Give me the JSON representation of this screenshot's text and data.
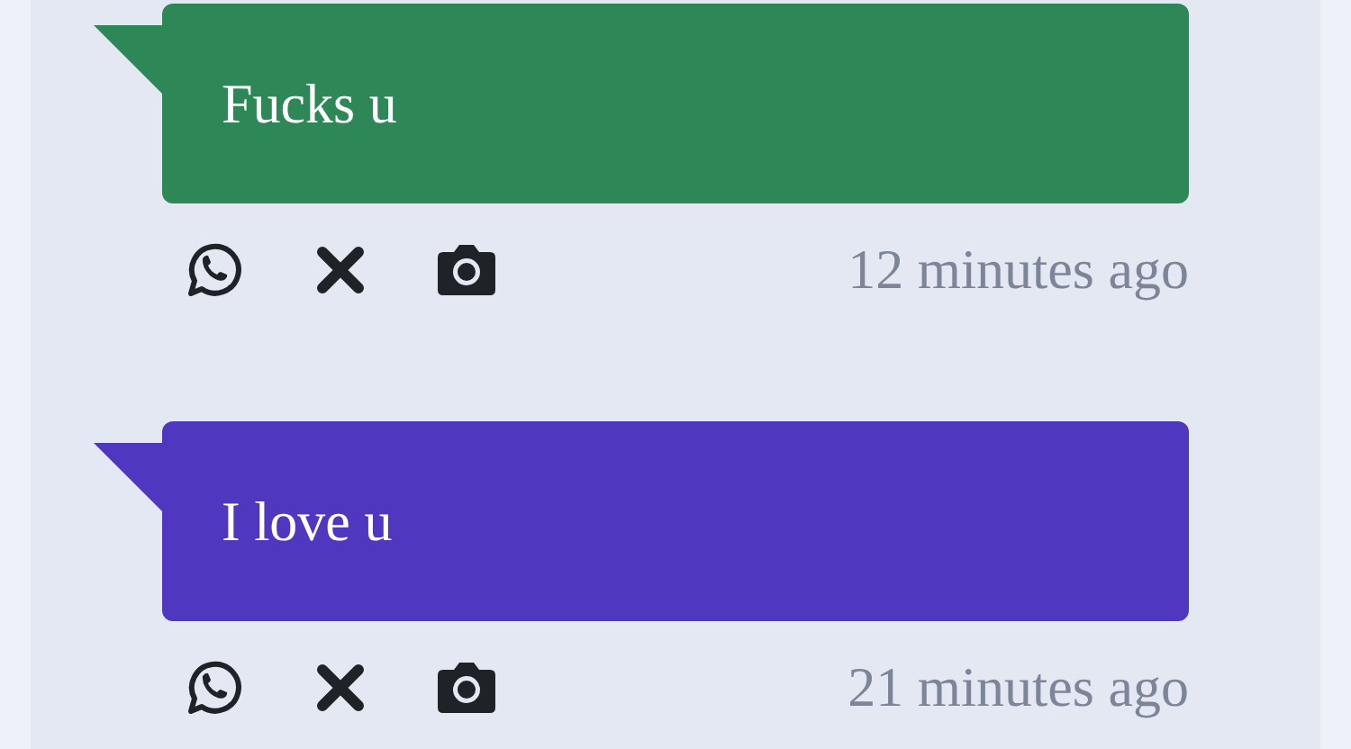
{
  "messages": [
    {
      "text": "Fucks u",
      "color": "#2e8757",
      "time": "12 minutes ago"
    },
    {
      "text": "I love u",
      "color": "#4f38bf",
      "time": "21 minutes ago"
    }
  ]
}
